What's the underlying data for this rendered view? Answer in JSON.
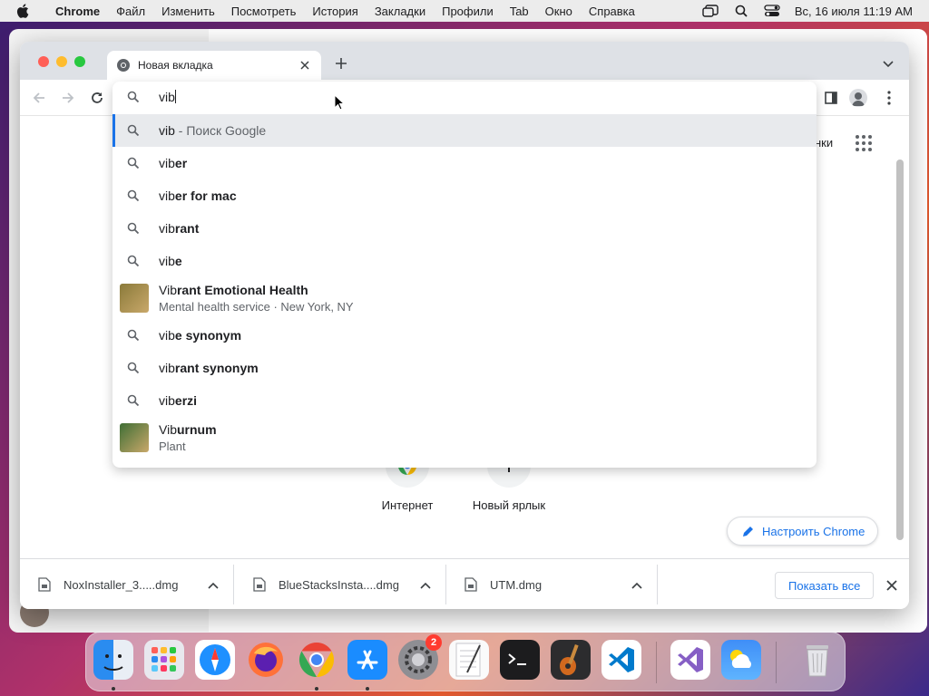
{
  "menubar": {
    "app_name": "Chrome",
    "items": [
      "Файл",
      "Изменить",
      "Посмотреть",
      "История",
      "Закладки",
      "Профили",
      "Tab",
      "Окно",
      "Справка"
    ],
    "datetime": "Вс, 16 июля  11:19 AM"
  },
  "browser": {
    "tab_title": "Новая вкладка",
    "omnibox_value": "vib",
    "suggestions": [
      {
        "prefix": "vib",
        "bold": "",
        "suffix": " - Поиск Google",
        "selected": true
      },
      {
        "prefix": "vib",
        "bold": "er",
        "suffix": ""
      },
      {
        "prefix": "vib",
        "bold": "er for mac",
        "suffix": ""
      },
      {
        "prefix": "vib",
        "bold": "rant",
        "suffix": ""
      },
      {
        "prefix": "vib",
        "bold": "e",
        "suffix": ""
      },
      {
        "prefix": "Vib",
        "bold": "rant Emotional Health",
        "subtitle": "Mental health service · New York, NY"
      },
      {
        "prefix": "vib",
        "bold": "e synonym",
        "suffix": ""
      },
      {
        "prefix": "vib",
        "bold": "rant synonym",
        "suffix": ""
      },
      {
        "prefix": "vib",
        "bold": "erzi",
        "suffix": ""
      },
      {
        "prefix": "Vib",
        "bold": "urnum",
        "subtitle": "Plant"
      }
    ],
    "ntp": {
      "right_link_partial": "нки",
      "shortcuts": [
        {
          "label": "Интернет"
        },
        {
          "label": "Новый ярлык"
        }
      ],
      "customize_label": "Настроить Chrome"
    },
    "downloads": [
      {
        "name": "NoxInstaller_3.....dmg"
      },
      {
        "name": "BlueStacksInsta....dmg"
      },
      {
        "name": "UTM.dmg"
      }
    ],
    "show_all_label": "Показать все"
  },
  "dock": {
    "items": [
      "finder-icon",
      "launchpad-icon",
      "safari-icon",
      "firefox-icon",
      "chrome-icon",
      "app-store-icon",
      "system-settings-icon",
      "textedit-icon",
      "terminal-icon",
      "garageband-icon",
      "vscode-icon",
      "visual-studio-icon",
      "weather-icon",
      "trash-icon"
    ],
    "settings_badge": "2"
  },
  "colors": {
    "accent": "#1a73e8",
    "tabstrip": "#dee1e6",
    "selected_row": "#e8eaed"
  }
}
